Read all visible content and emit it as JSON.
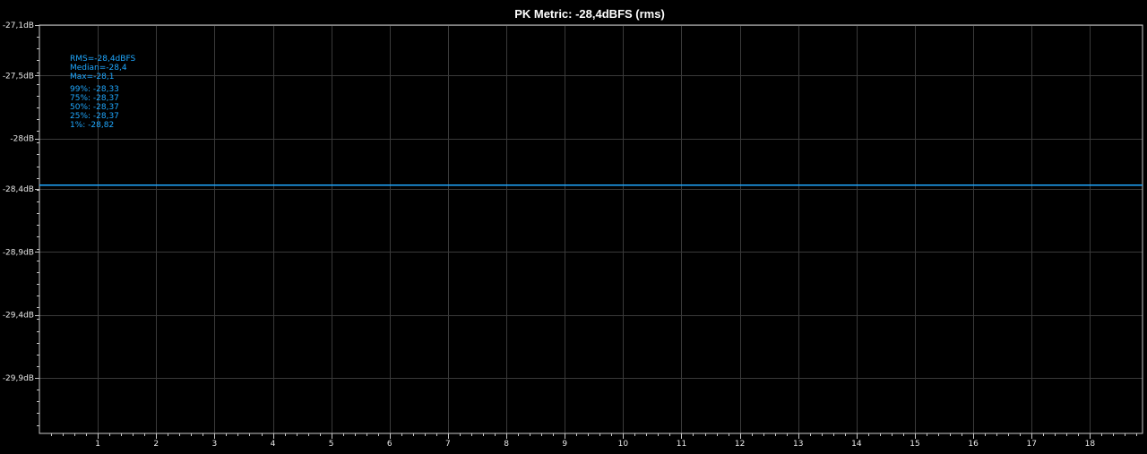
{
  "chart_data": {
    "type": "line",
    "title": "PK Metric: -28,4dBFS (rms)",
    "xlabel": "",
    "ylabel": "",
    "xlim": [
      0,
      18.9
    ],
    "ylim": [
      -30.34,
      -27.1
    ],
    "grid": true,
    "x_ticks": [
      1,
      2,
      3,
      4,
      5,
      6,
      7,
      8,
      9,
      10,
      11,
      12,
      13,
      14,
      15,
      16,
      17,
      18
    ],
    "x_tick_labels": [
      "1",
      "2",
      "3",
      "4",
      "5",
      "6",
      "7",
      "8",
      "9",
      "10",
      "11",
      "12",
      "13",
      "14",
      "15",
      "16",
      "17",
      "18"
    ],
    "y_ticks": [
      -27.1,
      -27.5,
      -28.0,
      -28.4,
      -28.9,
      -29.4,
      -29.9
    ],
    "y_tick_labels": [
      "-27,1dB",
      "-27,5dB",
      "-28dB",
      "-28,4dB",
      "-28,9dB",
      "-29,4dB",
      "-29,9dB"
    ],
    "series": [
      {
        "color": "#1fa8ff",
        "x": [
          0,
          18.9
        ],
        "y": [
          -28.37,
          -28.37
        ]
      }
    ],
    "stats": [
      "RMS=-28,4dBFS",
      "Median=-28,4",
      "Max=-28,1",
      "",
      "99%: -28,33",
      "75%: -28,37",
      "50%: -28,37",
      "25%: -28,37",
      "1%: -28,82"
    ]
  },
  "colors": {
    "background": "#000000",
    "grid": "#3a3a3a",
    "axis": "#c8c8c8",
    "series": "#1fa8ff",
    "text": "#e6e6e6"
  }
}
